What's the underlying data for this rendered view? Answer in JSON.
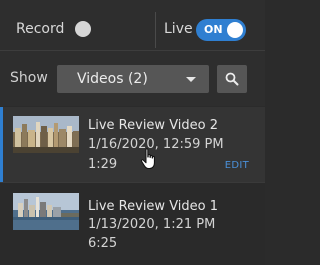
{
  "topbar": {
    "record_label": "Record",
    "record_on": false,
    "live_label": "Live",
    "live_toggle_text": "ON",
    "live_on": true
  },
  "filter": {
    "show_label": "Show",
    "selected_option": "Videos (2)"
  },
  "videos": [
    {
      "title": "Live Review Video 2",
      "date": "1/16/2020, 12:59 PM",
      "duration": "1:29",
      "edit_label": "EDIT",
      "selected": true
    },
    {
      "title": "Live Review Video 1",
      "date": "1/13/2020, 1:21 PM",
      "duration": "6:25",
      "selected": false
    }
  ],
  "colors": {
    "accent": "#2f7fd1",
    "background": "#2b2b2b",
    "control": "#565656"
  },
  "icons": [
    "search-icon",
    "hand-pointer-icon"
  ]
}
